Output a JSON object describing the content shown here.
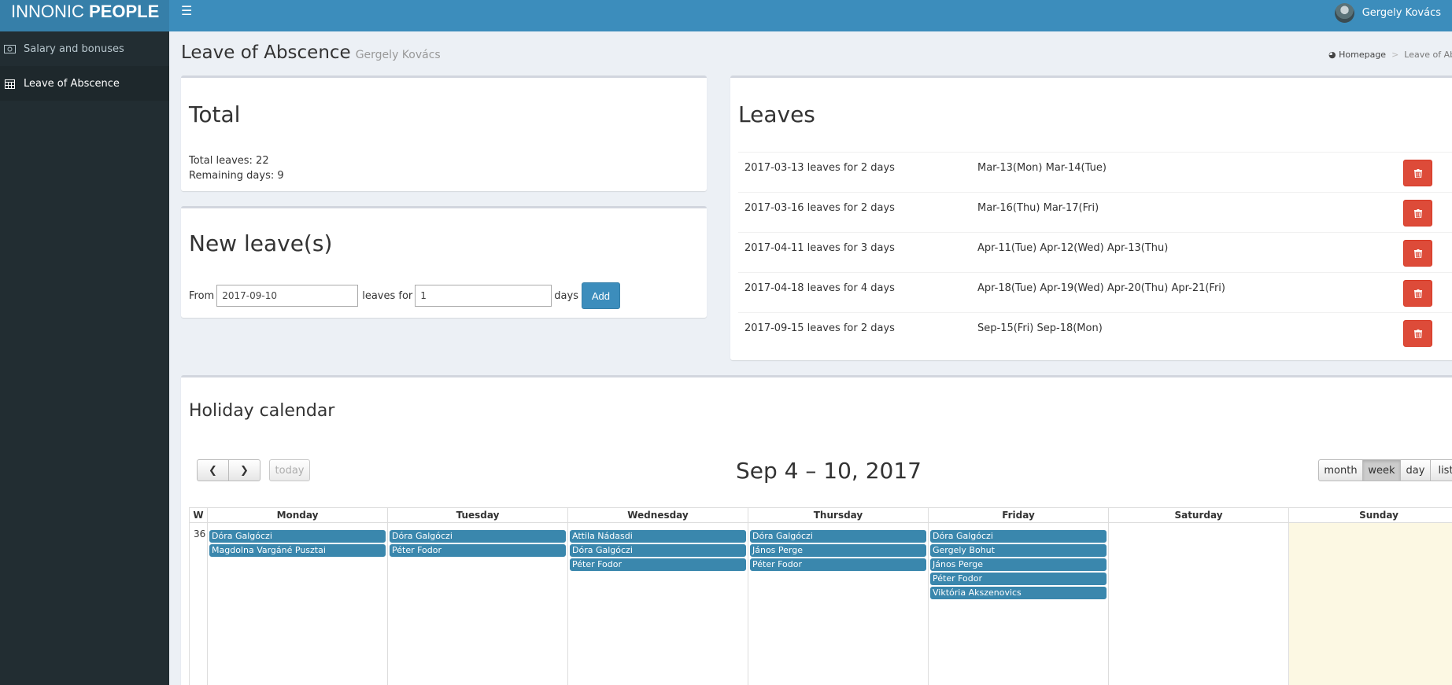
{
  "app": {
    "logo_light": "INNONIC",
    "logo_bold": "PEOPLE",
    "user_name": "Gergely Kovács"
  },
  "sidebar": {
    "items": [
      {
        "label": "Salary and bonuses",
        "icon": "money-icon"
      },
      {
        "label": "Leave of Abscence",
        "icon": "calendar-icon"
      }
    ]
  },
  "header": {
    "title": "Leave of Abscence",
    "subtitle": "Gergely Kovács",
    "breadcrumb_home": "Homepage",
    "breadcrumb_current": "Leave of Abs"
  },
  "total": {
    "title": "Total",
    "total_leaves": "Total leaves: 22",
    "remaining_days": "Remaining days: 9"
  },
  "new_leave": {
    "title": "New leave(s)",
    "from_label": "From",
    "from_value": "2017-09-10",
    "leaves_for_label": "leaves for",
    "days_value": "1",
    "days_label": "days",
    "add_label": "Add"
  },
  "leaves": {
    "title": "Leaves",
    "rows": [
      {
        "summary": "2017-03-13 leaves for 2 days",
        "days": "Mar-13(Mon) Mar-14(Tue)"
      },
      {
        "summary": "2017-03-16 leaves for 2 days",
        "days": "Mar-16(Thu) Mar-17(Fri)"
      },
      {
        "summary": "2017-04-11 leaves for 3 days",
        "days": "Apr-11(Tue) Apr-12(Wed) Apr-13(Thu)"
      },
      {
        "summary": "2017-04-18 leaves for 4 days",
        "days": "Apr-18(Tue) Apr-19(Wed) Apr-20(Thu) Apr-21(Fri)"
      },
      {
        "summary": "2017-09-15 leaves for 2 days",
        "days": "Sep-15(Fri) Sep-18(Mon)"
      }
    ]
  },
  "calendar": {
    "title": "Holiday calendar",
    "today_label": "today",
    "range_title": "Sep 4 – 10, 2017",
    "views": {
      "month": "month",
      "week": "week",
      "day": "day",
      "list": "list"
    },
    "week_header": "W",
    "week_number": "36",
    "days": [
      {
        "name": "Monday",
        "events": [
          "Dóra Galgóczi",
          "Magdolna Vargáné Pusztai"
        ]
      },
      {
        "name": "Tuesday",
        "events": [
          "Dóra Galgóczi",
          "Péter Fodor"
        ]
      },
      {
        "name": "Wednesday",
        "events": [
          "Attila Nádasdi",
          "Dóra Galgóczi",
          "Péter Fodor"
        ]
      },
      {
        "name": "Thursday",
        "events": [
          "Dóra Galgóczi",
          "János Perge",
          "Péter Fodor"
        ]
      },
      {
        "name": "Friday",
        "events": [
          "Dóra Galgóczi",
          "Gergely Bohut",
          "János Perge",
          "Péter Fodor",
          "Viktória Akszenovics"
        ]
      },
      {
        "name": "Saturday",
        "events": []
      },
      {
        "name": "Sunday",
        "events": []
      }
    ]
  }
}
